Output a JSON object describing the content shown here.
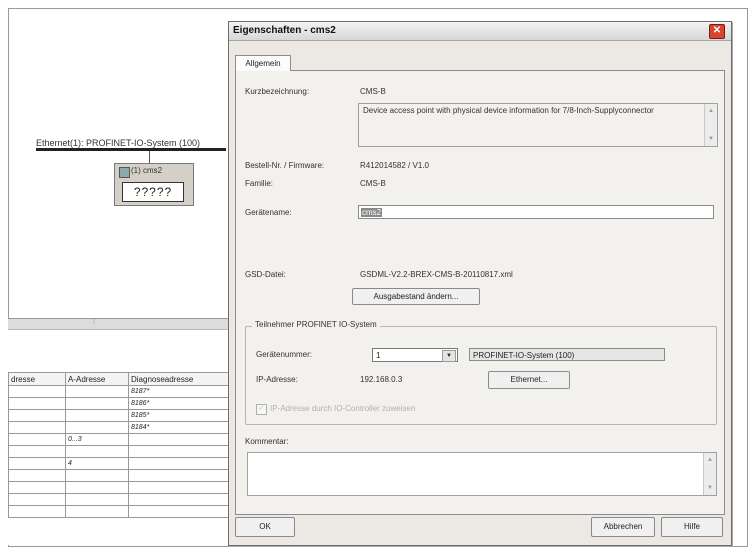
{
  "background": {
    "network_label": "Ethernet(1): PROFINET-IO-System (100)",
    "node": {
      "title": "(1) cms2",
      "placeholder": "?????"
    },
    "table": {
      "headers": [
        "dresse",
        "A-Adresse",
        "Diagnoseadresse"
      ],
      "rows": [
        [
          "",
          "",
          "8187*"
        ],
        [
          "",
          "",
          "8186*"
        ],
        [
          "",
          "",
          "8185*"
        ],
        [
          "",
          "",
          "8184*"
        ],
        [
          "",
          "0...3",
          ""
        ],
        [
          "",
          "",
          ""
        ],
        [
          "",
          "4",
          ""
        ],
        [
          "",
          "",
          ""
        ],
        [
          "",
          "",
          ""
        ],
        [
          "",
          "",
          ""
        ],
        [
          "",
          "",
          ""
        ]
      ]
    }
  },
  "dialog": {
    "title": "Eigenschaften - cms2",
    "tab": "Allgemein",
    "fields": {
      "kurz_label": "Kurzbezeichnung:",
      "kurz_value": "CMS-B",
      "description": "Device access point with physical device information for 7/8-Inch-Supplyconnector",
      "bestell_label": "Bestell-Nr. / Firmware:",
      "bestell_value": "R412014582 / V1.0",
      "familie_label": "Familie:",
      "familie_value": "CMS-B",
      "geraetename_label": "Gerätename:",
      "geraetename_value": "cms2",
      "gsd_label": "GSD-Datei:",
      "gsd_value": "GSDML-V2.2-BREX-CMS-B-20110817.xml",
      "ausgabe_button": "Ausgabestand ändern..."
    },
    "group": {
      "legend": "Teilnehmer PROFINET IO-System",
      "geraetenummer_label": "Gerätenummer:",
      "geraetenummer_value": "1",
      "subnet_value": "PROFINET-IO-System (100)",
      "ip_label": "IP-Adresse:",
      "ip_value": "192.168.0.3",
      "ethernet_button": "Ethernet...",
      "checkbox_label": "IP-Adresse durch IO-Controller zuweisen"
    },
    "kommentar_label": "Kommentar:",
    "ok_button": "OK",
    "cancel_button": "Abbrechen",
    "help_button": "Hilfe"
  }
}
